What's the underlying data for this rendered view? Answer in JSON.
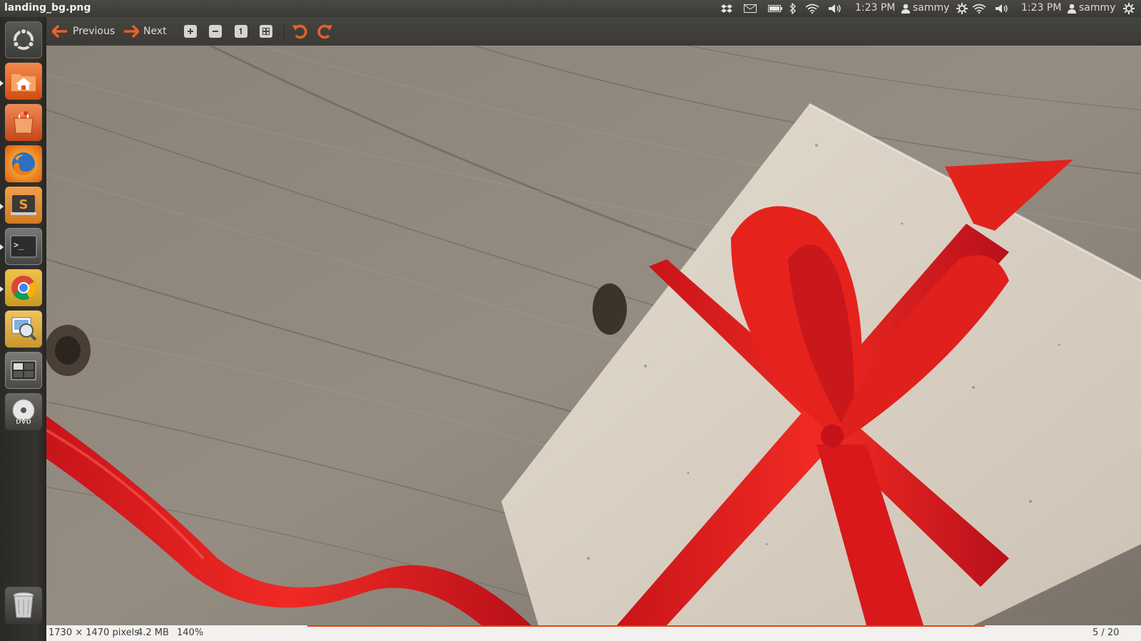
{
  "window": {
    "title": "landing_bg.png"
  },
  "panel": {
    "time_1": "1:23 PM",
    "user_1": "sammy",
    "time_2": "1:23 PM",
    "user_2": "sammy"
  },
  "toolbar": {
    "previous_label": "Previous",
    "next_label": "Next"
  },
  "launcher": {
    "items": [
      "dash-home",
      "home-folder",
      "software-center",
      "firefox",
      "sublime-text",
      "terminal",
      "chrome",
      "image-viewer",
      "workspace-switcher",
      "dvd",
      "trash"
    ]
  },
  "status": {
    "dimensions": "1730 × 1470 pixels",
    "size": "4.2 MB",
    "zoom": "140%",
    "position": "5 / 20"
  },
  "colors": {
    "accent": "#dd4814",
    "ribbon": "#e0201d",
    "wood": "#8c857b",
    "paper": "#d8cfc2"
  }
}
